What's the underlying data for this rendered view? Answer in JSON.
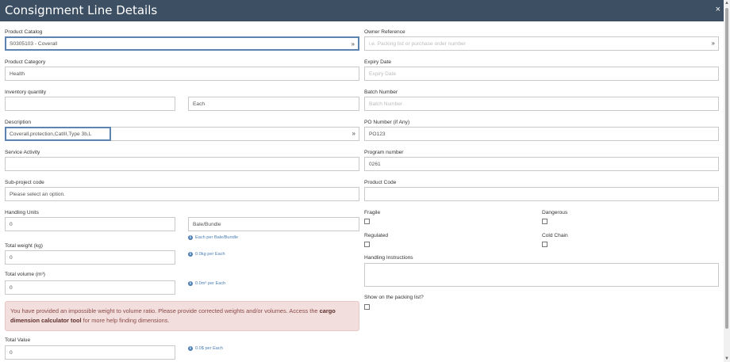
{
  "header": {
    "title": "Consignment Line Details",
    "close": "×"
  },
  "left": {
    "product_catalog": {
      "label": "Product Catalog",
      "value": "S0305103 - Coverall"
    },
    "product_category": {
      "label": "Product Category",
      "value": "Health"
    },
    "inventory_quantity": {
      "label": "Inventory quantity",
      "value": "",
      "unit": "Each"
    },
    "description": {
      "label": "Description",
      "value": "Coverall,protection,CatIII,Type 3b,L"
    },
    "service_activity": {
      "label": "Service Activity",
      "value": ""
    },
    "sub_project_code": {
      "label": "Sub-project code",
      "value": "Please select an option."
    },
    "handling_units": {
      "label": "Handling Units",
      "value": "0",
      "unit": "Bale/Bundle",
      "note": "Each per Bale/Bundle"
    },
    "total_weight": {
      "label": "Total weight (kg)",
      "value": "0",
      "note": "0.0kg per Each"
    },
    "total_volume": {
      "label": "Total volume (m³)",
      "value": "0",
      "note": "0.0m³ per Each"
    },
    "alert": {
      "text_before": "You have provided an impossible weight to volume ratio. Please provide corrected weights and/or volumes. Access the ",
      "link": "cargo dimension calculator tool",
      "text_after": " for more help finding dimensions."
    },
    "total_value": {
      "label": "Total Value",
      "value": "0",
      "note": "0.0$ per Each"
    }
  },
  "right": {
    "owner_reference": {
      "label": "Owner Reference",
      "placeholder": "i.e. Packing list or purchase order number"
    },
    "expiry_date": {
      "label": "Expiry Date",
      "placeholder": "Expiry Date"
    },
    "batch_number": {
      "label": "Batch Number",
      "placeholder": "Batch Number"
    },
    "po_number": {
      "label": "PO Number (if Any)",
      "value": "PO123"
    },
    "program_number": {
      "label": "Program number",
      "value": "0261"
    },
    "product_code": {
      "label": "Product Code",
      "value": ""
    },
    "fragile": {
      "label": "Fragile",
      "checked": false
    },
    "dangerous": {
      "label": "Dangerous",
      "checked": false
    },
    "regulated": {
      "label": "Regulated",
      "checked": false
    },
    "cold_chain": {
      "label": "Cold Chain",
      "checked": false
    },
    "handling_instructions": {
      "label": "Handling Instructions",
      "value": ""
    },
    "show_on_packing_list": {
      "label": "Show on the packing list?",
      "checked": false
    }
  },
  "colors": {
    "header_bg": "#3d4f63",
    "highlight": "#5b84b1",
    "alert_bg": "#f2dedd",
    "note": "#4b7eb3"
  },
  "icons": {
    "chevron": "double-chevron-down-icon",
    "info": "info-circle-icon",
    "close": "close-icon"
  }
}
